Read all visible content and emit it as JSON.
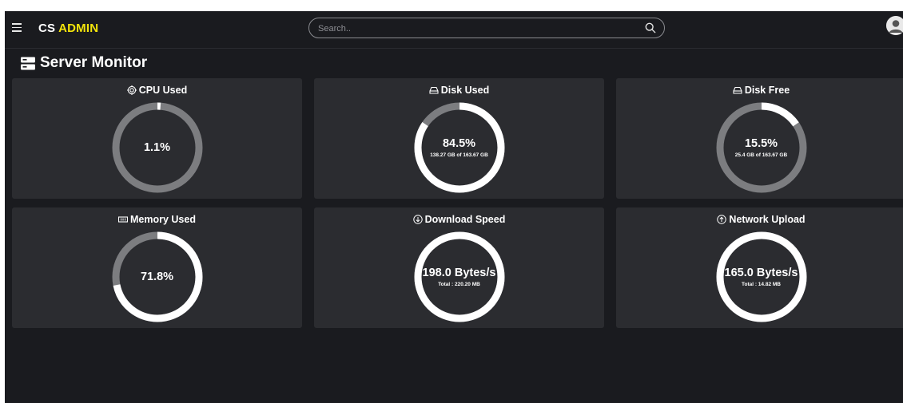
{
  "header": {
    "brand_prefix": "CS",
    "brand_accent": "ADMIN",
    "search_placeholder": "Search..",
    "accent_color": "#f3e40b"
  },
  "page": {
    "title": "Server Monitor"
  },
  "cards": [
    {
      "title": "CPU Used",
      "icon": "cpu-icon",
      "value": "1.1%",
      "subtext": "",
      "fill": 0.011
    },
    {
      "title": "Disk Used",
      "icon": "disk-icon",
      "value": "84.5%",
      "subtext": "138.27 GB of 163.67 GB",
      "fill": 0.845
    },
    {
      "title": "Disk Free",
      "icon": "disk-icon",
      "value": "15.5%",
      "subtext": "25.4 GB of 163.67 GB",
      "fill": 0.155
    },
    {
      "title": "Memory Used",
      "icon": "memory-icon",
      "value": "71.8%",
      "subtext": "",
      "fill": 0.718
    },
    {
      "title": "Download Speed",
      "icon": "download-icon",
      "value": "198.0 Bytes/s",
      "subtext": "Total : 220.20 MB",
      "fill": 1.0
    },
    {
      "title": "Network Upload",
      "icon": "upload-icon",
      "value": "165.0 Bytes/s",
      "subtext": "Total : 14.82 MB",
      "fill": 1.0
    }
  ],
  "colors": {
    "gauge_fill": "#ffffff",
    "gauge_track": "#7c7d80",
    "card_bg": "#2b2c30",
    "page_bg": "#1a1b1f"
  }
}
